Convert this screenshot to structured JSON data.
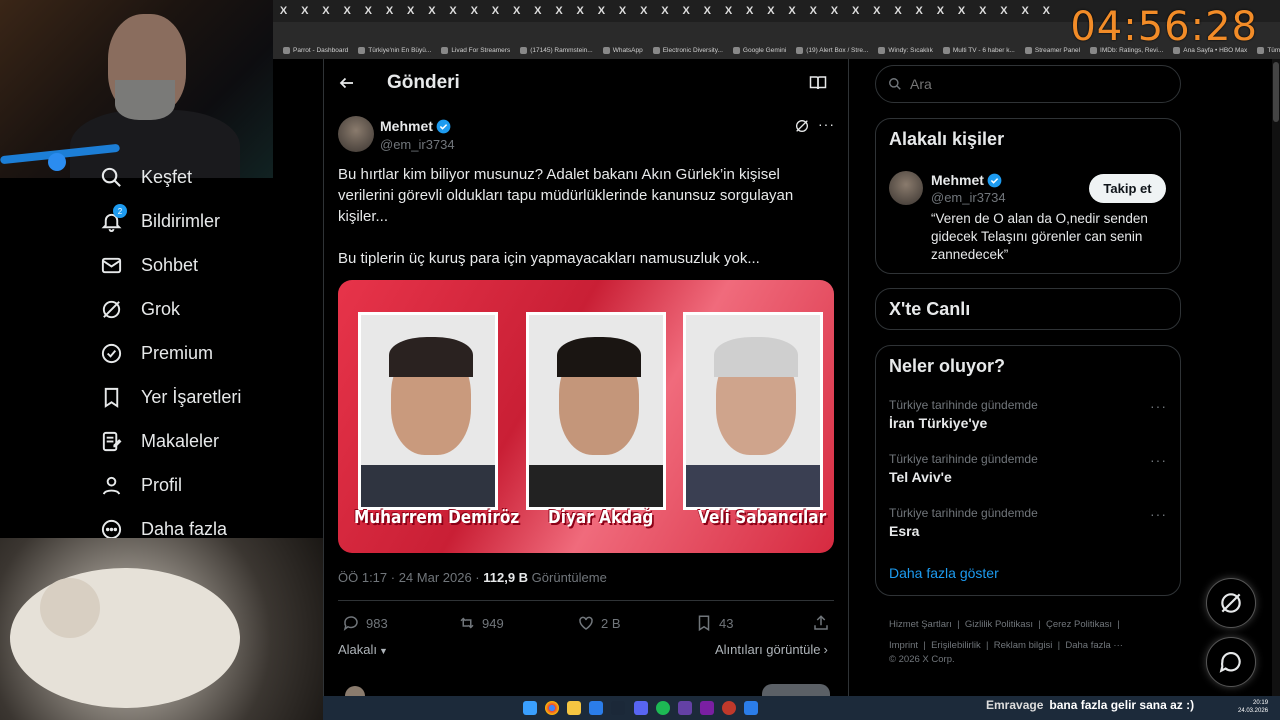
{
  "browser": {
    "tab_glyph": "X",
    "tab_count": 37,
    "bookmarks": [
      "Parrot - Dashboard",
      "Türkiye'nin En Büyü...",
      "Livad For Streamers",
      "(17145) Rammstein...",
      "WhatsApp",
      "Electronic Diversity...",
      "Google Gemini",
      "(19) Alert Box / Stre...",
      "Windy: Sıcaklık",
      "Multi TV - 6 haber k...",
      "Streamer Panel",
      "IMDb: Ratings, Revi...",
      "Ana Sayfa • HBO Max",
      "Tüm Yer İşaretleri"
    ]
  },
  "timer": "04:56:28",
  "nav": {
    "items": [
      {
        "label": "Keşfet",
        "icon": "search-icon"
      },
      {
        "label": "Bildirimler",
        "icon": "bell-icon",
        "badge": "2"
      },
      {
        "label": "Sohbet",
        "icon": "mail-icon"
      },
      {
        "label": "Grok",
        "icon": "grok-icon"
      },
      {
        "label": "Premium",
        "icon": "verified-icon"
      },
      {
        "label": "Yer İşaretleri",
        "icon": "bookmark-icon"
      },
      {
        "label": "Makaleler",
        "icon": "article-icon"
      },
      {
        "label": "Profil",
        "icon": "person-icon"
      },
      {
        "label": "Daha fazla",
        "icon": "more-circle-icon"
      }
    ]
  },
  "header": {
    "title": "Gönderi"
  },
  "post": {
    "name": "Mehmet",
    "handle": "@em_ir3734",
    "text1": "Bu hırtlar kim biliyor musunuz? Adalet bakanı Akın Gürlek’in kişisel verilerini görevli oldukları tapu müdürlüklerinde kanunsuz sorgulayan kişiler...",
    "text2": "Bu tiplerin üç kuruş para için yapmayacakları namusuzluk yok...",
    "image_captions": [
      "Muharrem Demiröz",
      "Diyar Akdağ",
      "Veli Sabancılar"
    ],
    "meta_time": "ÖÖ 1:17 · 24 Mar 2026 · ",
    "views": "112,9 B",
    "views_label": " Görüntüleme",
    "stats": {
      "replies": "983",
      "reposts": "949",
      "likes": "2 B",
      "bookmarks": "43"
    },
    "related_label": "Alakalı",
    "quotes_label": "Alıntıları görüntüle"
  },
  "search": {
    "placeholder": "Ara"
  },
  "related_people": {
    "title": "Alakalı kişiler",
    "name": "Mehmet",
    "handle": "@em_ir3734",
    "follow_label": "Takip et",
    "bio": "“Veren de O alan da O,nedir senden gidecek Telaşını görenler can senin zannedecek”"
  },
  "live": {
    "title": "X'te Canlı"
  },
  "trends": {
    "title": "Neler oluyor?",
    "items": [
      {
        "category": "Türkiye tarihinde gündemde",
        "title": "İran Türkiye'ye"
      },
      {
        "category": "Türkiye tarihinde gündemde",
        "title": "Tel Aviv'e"
      },
      {
        "category": "Türkiye tarihinde gündemde",
        "title": "Esra"
      }
    ],
    "show_more": "Daha fazla göster"
  },
  "footer": {
    "links": [
      "Hizmet Şartları",
      "Gizlilik Politikası",
      "Çerez Politikası",
      "Imprint",
      "Erişilebilirlik",
      "Reklam bilgisi",
      "Daha fazla ···"
    ],
    "copyright": "© 2026 X Corp."
  },
  "taskbar": {
    "chat_user": "Emravage",
    "chat_msg": "bana fazla gelir sana az :)",
    "time": "20:19",
    "date": "24.03.2026"
  },
  "colors": {
    "accent": "#1d9bf0",
    "timer": "#f28c28",
    "border": "#2f3336",
    "muted": "#71767b"
  }
}
